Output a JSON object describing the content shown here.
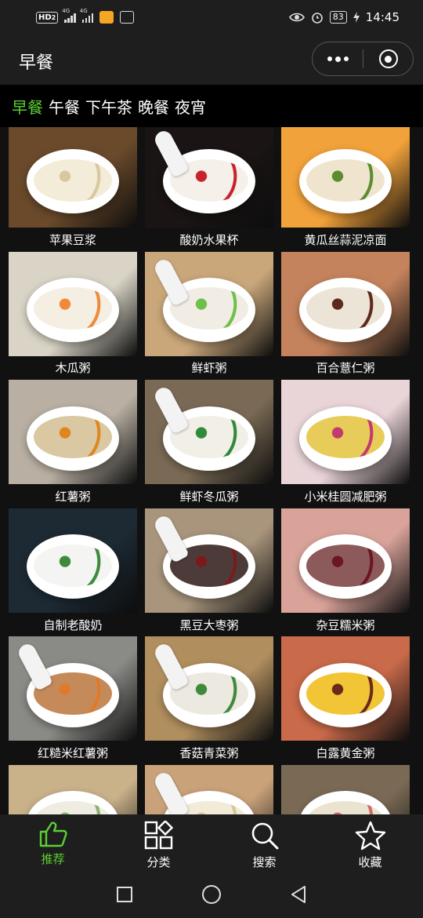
{
  "status_bar": {
    "hd_badge": "HD",
    "sim_index": "2",
    "net_1": "4G",
    "net_2": "4G",
    "battery": "83",
    "time": "14:45"
  },
  "header": {
    "title": "早餐"
  },
  "tabs": [
    {
      "label": "早餐",
      "active": true
    },
    {
      "label": "午餐",
      "active": false
    },
    {
      "label": "下午茶",
      "active": false
    },
    {
      "label": "晚餐",
      "active": false
    },
    {
      "label": "夜宵",
      "active": false
    }
  ],
  "recipes": [
    {
      "name": "苹果豆浆",
      "palette": [
        "#6b4a2b",
        "#f3ecd8",
        "#d9c79f"
      ]
    },
    {
      "name": "酸奶水果杯",
      "palette": [
        "#1a1414",
        "#f5f1ea",
        "#c8232c"
      ]
    },
    {
      "name": "黄瓜丝蒜泥凉面",
      "palette": [
        "#f2a23a",
        "#efe5cf",
        "#5b8c2e"
      ]
    },
    {
      "name": "木瓜粥",
      "palette": [
        "#d9d4c6",
        "#f4efe2",
        "#f08a3a"
      ]
    },
    {
      "name": "鲜虾粥",
      "palette": [
        "#c9a77a",
        "#f1ede4",
        "#6fbf4a"
      ]
    },
    {
      "name": "百合薏仁粥",
      "palette": [
        "#c4835c",
        "#ece4d6",
        "#5b2a1c"
      ]
    },
    {
      "name": "红薯粥",
      "palette": [
        "#b9b0a3",
        "#d9c8a2",
        "#e0861f"
      ]
    },
    {
      "name": "鲜虾冬瓜粥",
      "palette": [
        "#7a6a55",
        "#f2efe7",
        "#2f8a3a"
      ]
    },
    {
      "name": "小米桂圆减肥粥",
      "palette": [
        "#e9d4d8",
        "#e8cc5a",
        "#c43a6e"
      ]
    },
    {
      "name": "自制老酸奶",
      "palette": [
        "#1d2a34",
        "#f4f4f2",
        "#3e8a3a"
      ]
    },
    {
      "name": "黑豆大枣粥",
      "palette": [
        "#a8957c",
        "#4d3b3a",
        "#7a1a1a"
      ]
    },
    {
      "name": "杂豆糯米粥",
      "palette": [
        "#d9a39a",
        "#8c5a5a",
        "#6a1624"
      ]
    },
    {
      "name": "红糙米红薯粥",
      "palette": [
        "#8a8a86",
        "#c48a5a",
        "#e07a2a"
      ]
    },
    {
      "name": "香菇青菜粥",
      "palette": [
        "#b08e5e",
        "#ece9e0",
        "#3e8a3a"
      ]
    },
    {
      "name": "白露黄金粥",
      "palette": [
        "#c96a4a",
        "#f1c536",
        "#6a2a1a"
      ]
    },
    {
      "name": "",
      "palette": [
        "#c9b18a",
        "#efece2",
        "#8ab070"
      ]
    },
    {
      "name": "",
      "palette": [
        "#c9a27a",
        "#f1ebd8",
        "#d8c69a"
      ]
    },
    {
      "name": "",
      "palette": [
        "#7a6a55",
        "#eae3d0",
        "#d06a6a"
      ]
    }
  ],
  "tabbar": [
    {
      "label": "推荐",
      "icon": "thumbs-up-icon",
      "active": true
    },
    {
      "label": "分类",
      "icon": "category-grid-icon",
      "active": false
    },
    {
      "label": "搜索",
      "icon": "search-icon",
      "active": false
    },
    {
      "label": "收藏",
      "icon": "star-icon",
      "active": false
    }
  ],
  "colors": {
    "accent": "#5bd033",
    "background": "#111111",
    "bar": "#1e1e1e"
  }
}
